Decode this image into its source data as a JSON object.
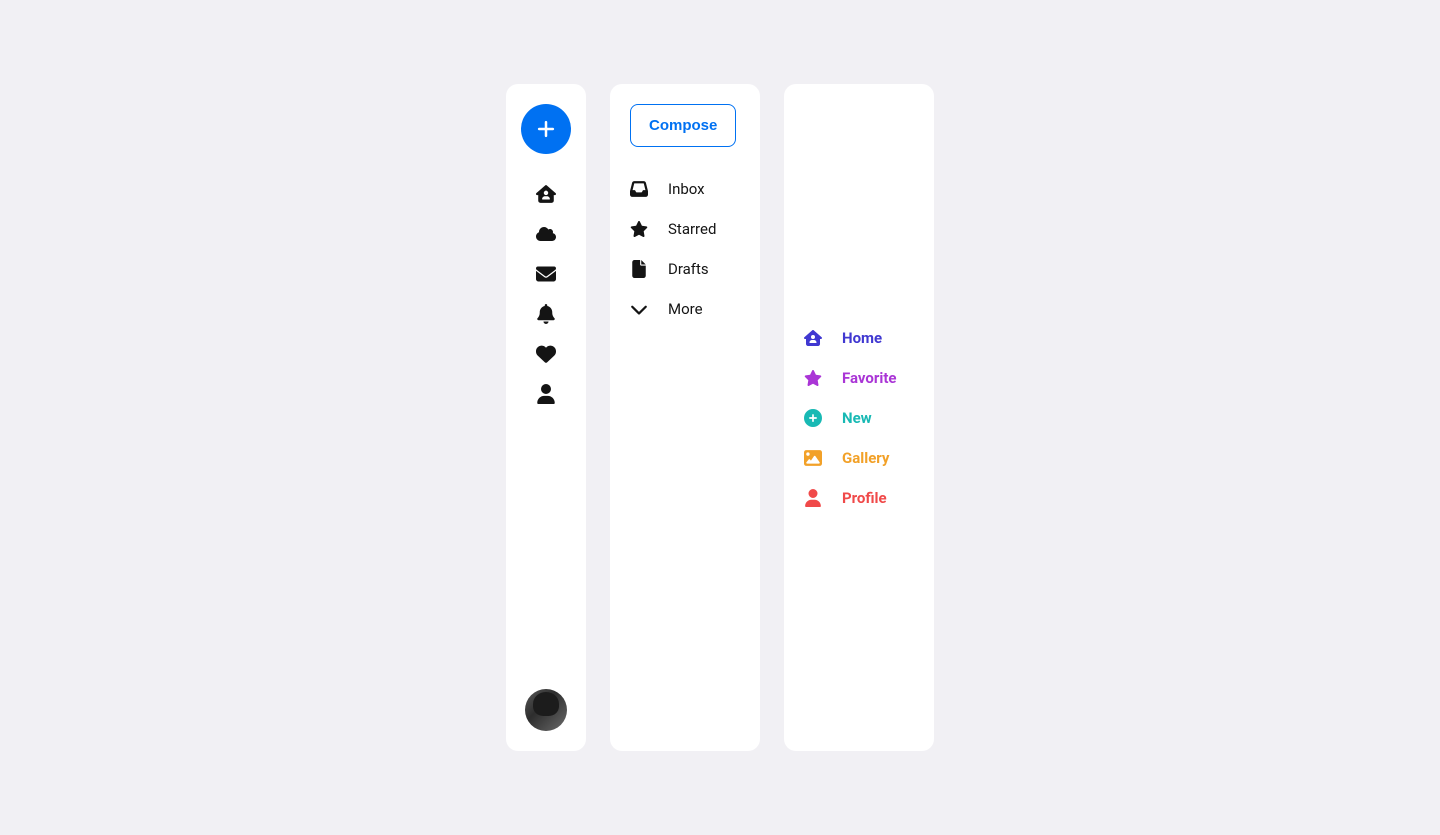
{
  "panel2": {
    "compose_label": "Compose",
    "items": [
      {
        "label": "Inbox"
      },
      {
        "label": "Starred"
      },
      {
        "label": "Drafts"
      },
      {
        "label": "More"
      }
    ]
  },
  "panel3": {
    "items": [
      {
        "label": "Home"
      },
      {
        "label": "Favorite"
      },
      {
        "label": "New"
      },
      {
        "label": "Gallery"
      },
      {
        "label": "Profile"
      }
    ]
  }
}
